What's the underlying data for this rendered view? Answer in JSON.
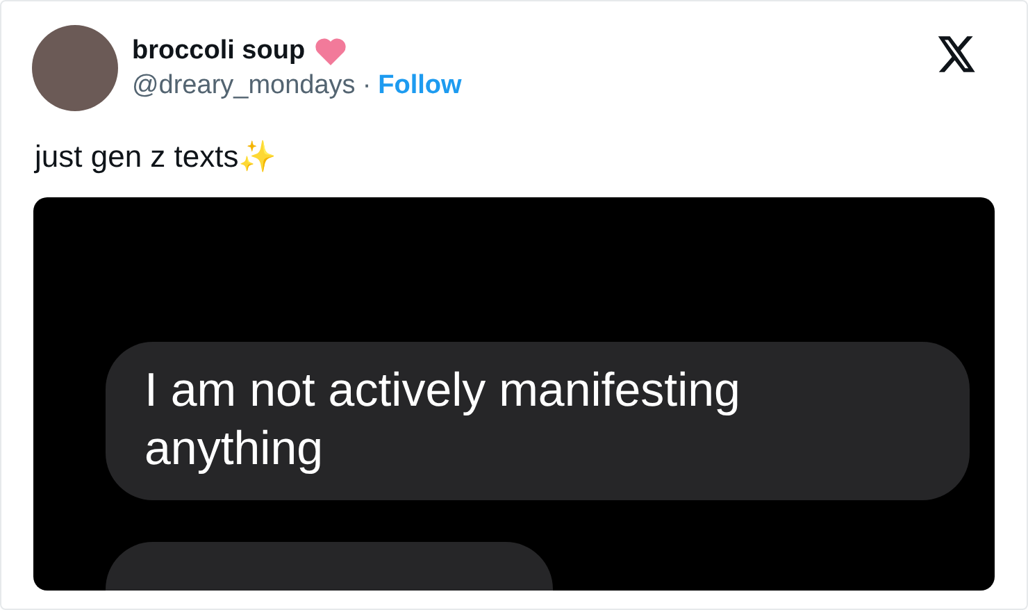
{
  "author": {
    "name": "broccoli soup",
    "handle": "@dreary_mondays",
    "separator": "·",
    "follow": "Follow"
  },
  "text": "just gen z texts✨",
  "media": {
    "kind": "chat",
    "bubbles": [
      {
        "kind": "text",
        "text": "I am not actively manifesting anything"
      },
      {
        "kind": "cut-off"
      }
    ]
  }
}
